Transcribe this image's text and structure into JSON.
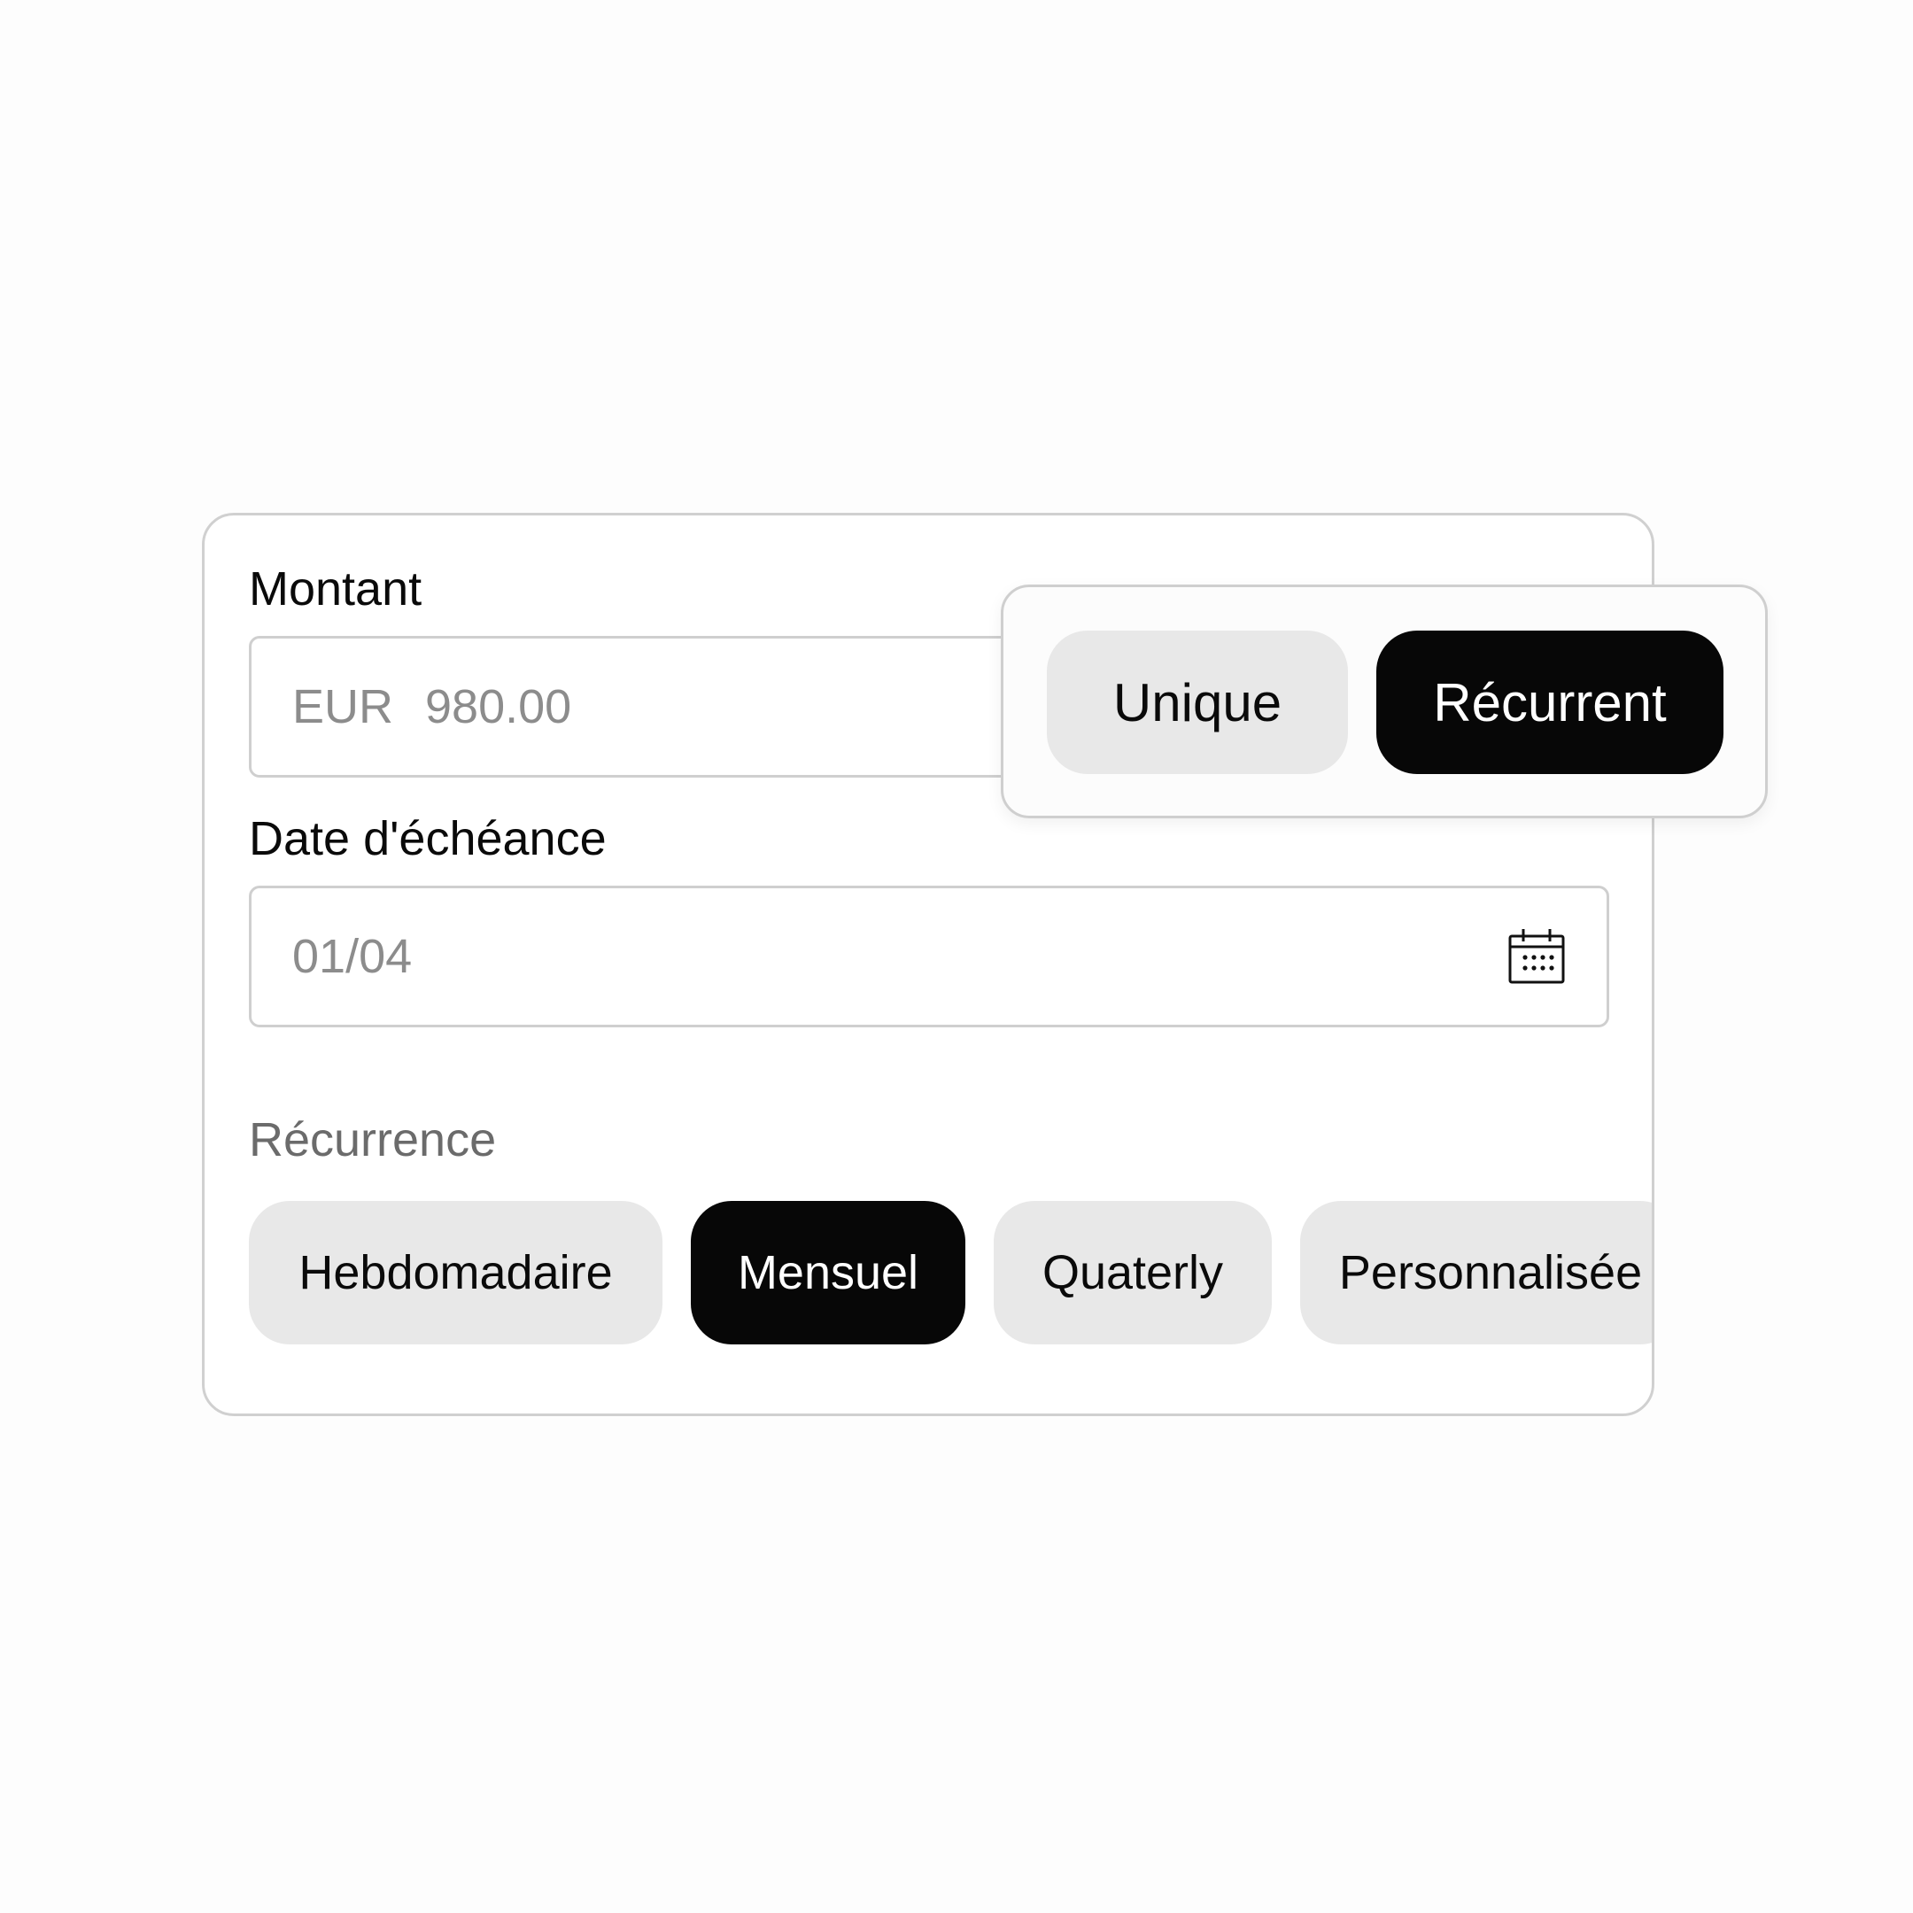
{
  "form": {
    "amount_label": "Montant",
    "amount_currency": "EUR",
    "amount_value": "980.00",
    "due_date_label": "Date d'échéance",
    "due_date_value": "01/04",
    "recurrence_label": "Récurrence",
    "recurrence_options": [
      {
        "label": "Hebdomadaire",
        "selected": false
      },
      {
        "label": "Mensuel",
        "selected": true
      },
      {
        "label": "Quaterly",
        "selected": false
      },
      {
        "label": "Personnalisée",
        "selected": false
      }
    ]
  },
  "payment_type_toggle": {
    "options": [
      {
        "label": "Unique",
        "selected": false
      },
      {
        "label": "Récurrent",
        "selected": true
      }
    ]
  },
  "icons": {
    "calendar": "calendar-icon"
  },
  "colors": {
    "selected_bg": "#070707",
    "unselected_bg": "#e8e8e8",
    "border": "#d0d0d0",
    "placeholder_text": "#8c8c8c"
  }
}
